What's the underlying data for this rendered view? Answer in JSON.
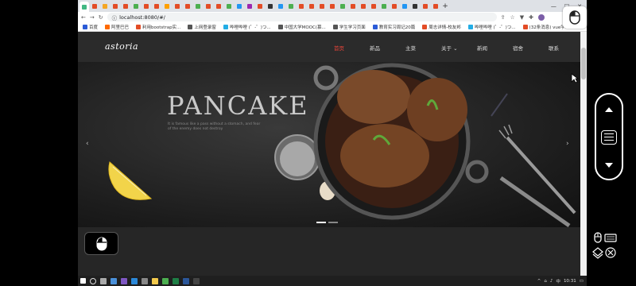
{
  "browser": {
    "url": "localhost:8080/#/",
    "bookmarks": [
      "百度",
      "阿里巴巴",
      "利用bootstrap实...",
      "上网登录窗",
      "哔哩哔哩 (゜-゜)つ...",
      "中国大学MOOC(慕...",
      "学生学习页面",
      "教育实习周记20篇",
      "周志详情-校友邦",
      "哔哩哔哩 (゜-゜)つ...",
      "(32条消息) vue学..."
    ]
  },
  "site": {
    "logo": "astoria",
    "menu": [
      "首页",
      "新品",
      "主菜",
      "关于",
      "新闻",
      "宿舍",
      "联系"
    ],
    "active_menu": "首页",
    "hero_title": "PANCAKE",
    "hero_subtitle": "It is famous like a pass without a stomach, and fear of the enemy does not destroy"
  },
  "taskbar": {
    "time": "10:31",
    "lang": "中"
  },
  "colors": {
    "accent": "#e8443a",
    "nav_bg": "#2b2b2b",
    "page_bg": "#262626"
  }
}
